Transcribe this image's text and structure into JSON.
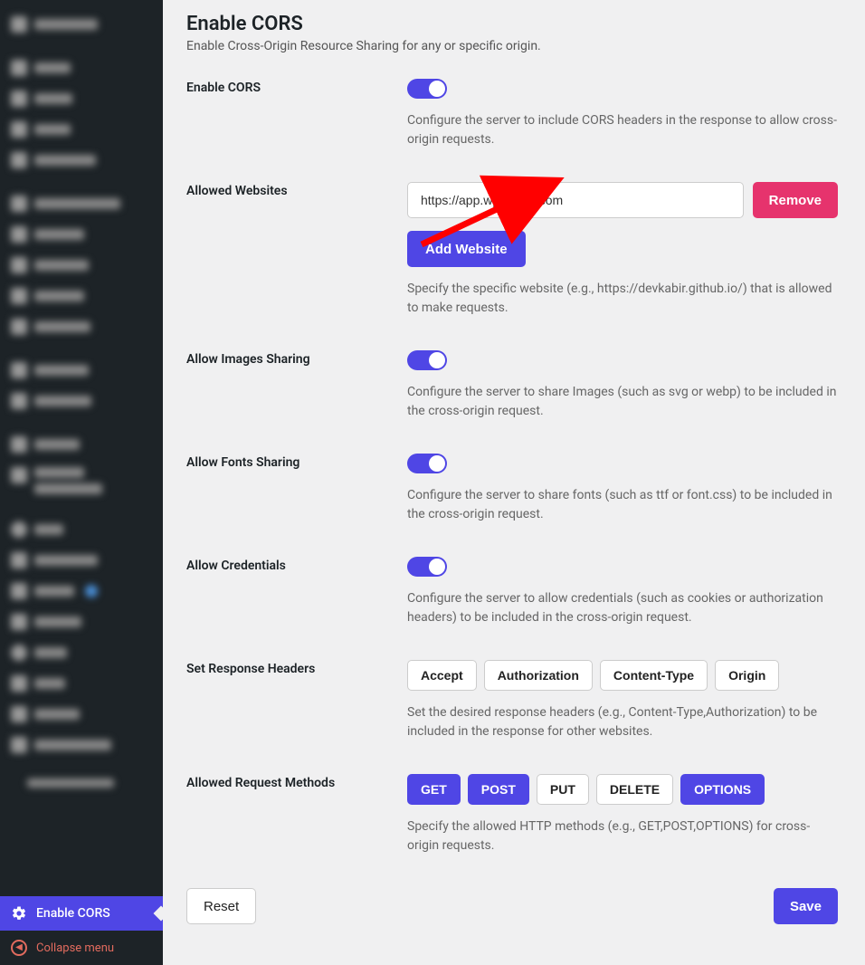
{
  "sidebar": {
    "active_label": "Enable CORS",
    "collapse_label": "Collapse menu"
  },
  "page": {
    "title": "Enable CORS",
    "subtitle": "Enable Cross-Origin Resource Sharing for any or specific origin."
  },
  "enable_cors": {
    "label": "Enable CORS",
    "on": true,
    "help": "Configure the server to include CORS headers in the response to allow cross-origin requests."
  },
  "allowed_websites": {
    "label": "Allowed Websites",
    "value": "https://app.wpmailkit.com",
    "remove": "Remove",
    "add": "Add Website",
    "help": "Specify the specific website (e.g., https://devkabir.github.io/) that is allowed to make requests."
  },
  "images": {
    "label": "Allow Images Sharing",
    "on": true,
    "help": "Configure the server to share Images (such as svg or webp) to be included in the cross-origin request."
  },
  "fonts": {
    "label": "Allow Fonts Sharing",
    "on": true,
    "help": "Configure the server to share fonts (such as ttf or font.css) to be included in the cross-origin request."
  },
  "credentials": {
    "label": "Allow Credentials",
    "on": true,
    "help": "Configure the server to allow credentials (such as cookies or authorization headers) to be included in the cross-origin request."
  },
  "response_headers": {
    "label": "Set Response Headers",
    "options": [
      {
        "text": "Accept",
        "selected": false
      },
      {
        "text": "Authorization",
        "selected": false
      },
      {
        "text": "Content-Type",
        "selected": false
      },
      {
        "text": "Origin",
        "selected": false
      }
    ],
    "help": "Set the desired response headers (e.g., Content-Type,Authorization) to be included in the response for other websites."
  },
  "request_methods": {
    "label": "Allowed Request Methods",
    "options": [
      {
        "text": "GET",
        "selected": true
      },
      {
        "text": "POST",
        "selected": true
      },
      {
        "text": "PUT",
        "selected": false
      },
      {
        "text": "DELETE",
        "selected": false
      },
      {
        "text": "OPTIONS",
        "selected": true
      }
    ],
    "help": "Specify the allowed HTTP methods (e.g., GET,POST,OPTIONS) for cross-origin requests."
  },
  "footer": {
    "reset": "Reset",
    "save": "Save"
  }
}
